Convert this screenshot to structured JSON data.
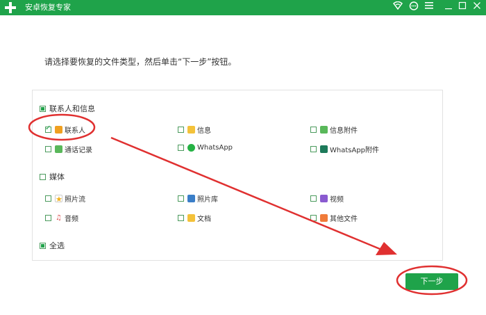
{
  "app": {
    "title": "安卓恢复专家"
  },
  "titlebar_icons": {
    "wifi": "wifi-icon",
    "chat": "chat-icon",
    "menu": "menu-icon",
    "minimize": "minimize-icon",
    "maximize": "maximize-icon",
    "close": "close-icon"
  },
  "instruction": "请选择要恢复的文件类型，然后单击“下一步”按钮。",
  "categories": {
    "contacts_messages": {
      "label": "联系人和信息",
      "state": "partial",
      "items": [
        {
          "label": "联系人",
          "checked": true,
          "icon": "contact-icon"
        },
        {
          "label": "信息",
          "checked": false,
          "icon": "message-icon"
        },
        {
          "label": "信息附件",
          "checked": false,
          "icon": "attachment-icon"
        },
        {
          "label": "通话记录",
          "checked": false,
          "icon": "phone-icon"
        },
        {
          "label": "WhatsApp",
          "checked": false,
          "icon": "whatsapp-icon"
        },
        {
          "label": "WhatsApp附件",
          "checked": false,
          "icon": "whatsapp-attachment-icon"
        }
      ]
    },
    "media": {
      "label": "媒体",
      "state": "unchecked",
      "items": [
        {
          "label": "照片流",
          "checked": false,
          "icon": "photo-stream-icon"
        },
        {
          "label": "照片库",
          "checked": false,
          "icon": "photo-library-icon"
        },
        {
          "label": "视频",
          "checked": false,
          "icon": "video-icon"
        },
        {
          "label": "音频",
          "checked": false,
          "icon": "audio-icon"
        },
        {
          "label": "文档",
          "checked": false,
          "icon": "document-icon"
        },
        {
          "label": "其他文件",
          "checked": false,
          "icon": "other-files-icon"
        }
      ]
    },
    "select_all": {
      "label": "全选",
      "state": "partial"
    }
  },
  "buttons": {
    "next": "下一步"
  },
  "colors": {
    "brand": "#1fa34a",
    "annotation": "#e03030"
  }
}
